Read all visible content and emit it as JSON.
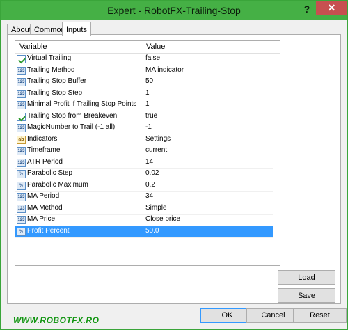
{
  "window": {
    "title": "Expert - RobotFX-Trailing-Stop",
    "help_glyph": "?",
    "close_glyph": "✕"
  },
  "tabs": [
    {
      "label": "About"
    },
    {
      "label": "Common"
    },
    {
      "label": "Inputs"
    }
  ],
  "grid": {
    "headers": {
      "variable": "Variable",
      "value": "Value"
    },
    "rows": [
      {
        "icon": "bool-icon",
        "name": "Virtual Trailing",
        "value": "false"
      },
      {
        "icon": "int-icon",
        "name": "Trailing Method",
        "value": "MA indicator"
      },
      {
        "icon": "int-icon",
        "name": "Trailing Stop Buffer",
        "value": "50"
      },
      {
        "icon": "int-icon",
        "name": "Trailing Stop Step",
        "value": "1"
      },
      {
        "icon": "int-icon",
        "name": "Minimal Profit if Trailing Stop Points",
        "value": "1"
      },
      {
        "icon": "bool-icon",
        "name": "Trailing Stop from Breakeven",
        "value": "true"
      },
      {
        "icon": "int-icon",
        "name": "MagicNumber to Trail (-1 all)",
        "value": "-1"
      },
      {
        "icon": "string-icon",
        "name": "Indicators",
        "value": "Settings"
      },
      {
        "icon": "int-icon",
        "name": "Timeframe",
        "value": "current"
      },
      {
        "icon": "int-icon",
        "name": "ATR Period",
        "value": "14"
      },
      {
        "icon": "double-icon",
        "name": "Parabolic Step",
        "value": "0.02"
      },
      {
        "icon": "double-icon",
        "name": "Parabolic Maximum",
        "value": "0.2"
      },
      {
        "icon": "int-icon",
        "name": "MA Period",
        "value": "34"
      },
      {
        "icon": "int-icon",
        "name": "MA Method",
        "value": "Simple"
      },
      {
        "icon": "int-icon",
        "name": "MA Price",
        "value": "Close price"
      },
      {
        "icon": "double-icon",
        "name": "Profit Percent",
        "value": "50.0",
        "selected": true
      }
    ]
  },
  "side_buttons": {
    "load": "Load",
    "save": "Save"
  },
  "footer": {
    "ok": "OK",
    "cancel": "Cancel",
    "reset": "Reset",
    "watermark": "WWW.ROBOTFX.RO"
  }
}
